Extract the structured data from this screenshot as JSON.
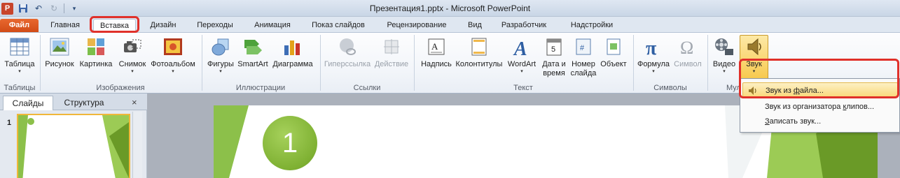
{
  "window": {
    "title": "Презентация1.pptx - Microsoft PowerPoint",
    "logo": "P"
  },
  "tabs": [
    {
      "label": "Файл"
    },
    {
      "label": "Главная"
    },
    {
      "label": "Вставка"
    },
    {
      "label": "Дизайн"
    },
    {
      "label": "Переходы"
    },
    {
      "label": "Анимация"
    },
    {
      "label": "Показ слайдов"
    },
    {
      "label": "Рецензирование"
    },
    {
      "label": "Вид"
    },
    {
      "label": "Разработчик"
    },
    {
      "label": "Надстройки"
    }
  ],
  "ribbon": {
    "groups": {
      "tables": "Таблицы",
      "images": "Изображения",
      "illustrations": "Иллюстрации",
      "links": "Ссылки",
      "text": "Текст",
      "symbols": "Символы",
      "media": "Мульт"
    },
    "buttons": {
      "table": "Таблица",
      "picture": "Рисунок",
      "clipart": "Картинка",
      "screenshot": "Снимок",
      "photoalbum": "Фотоальбом",
      "shapes": "Фигуры",
      "smartart": "SmartArt",
      "chart": "Диаграмма",
      "hyperlink": "Гиперссылка",
      "action": "Действие",
      "textbox": "Надпись",
      "headerfooter": "Колонтитулы",
      "wordart": "WordArt",
      "datetime_1": "Дата и",
      "datetime_2": "время",
      "slidenum_1": "Номер",
      "slidenum_2": "слайда",
      "object": "Объект",
      "equation": "Формула",
      "symbol": "Символ",
      "video": "Видео",
      "audio": "Звук"
    }
  },
  "audio_menu": {
    "items": [
      {
        "pre": "Звук из ",
        "ul": "ф",
        "post": "айла..."
      },
      {
        "pre": "Звук из организатора ",
        "ul": "к",
        "post": "липов..."
      },
      {
        "pre": "",
        "ul": "З",
        "post": "аписать звук..."
      }
    ]
  },
  "slides_pane": {
    "tab_slides": "Слайды",
    "tab_outline": "Структура",
    "close": "×",
    "thumb_number": "1"
  },
  "slide": {
    "number_badge": "1"
  },
  "colors": {
    "file_tab": "#d24c17",
    "highlight": "#e0302a",
    "accent_green": "#7fb133",
    "selection": "#f7c94e"
  }
}
